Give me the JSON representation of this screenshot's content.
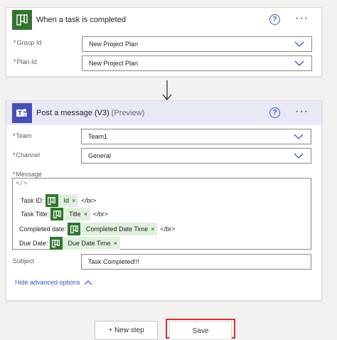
{
  "trigger": {
    "title": "When a task is completed",
    "fields": [
      {
        "label": "Group Id",
        "value": "New Project Plan"
      },
      {
        "label": "Plan Id",
        "value": "New Project Plan"
      }
    ],
    "help_glyph": "?",
    "more_glyph": "···"
  },
  "action": {
    "title": "Post a message (V3)",
    "preview_tag": "(Preview)",
    "help_glyph": "?",
    "more_glyph": "···",
    "team": {
      "label": "Team",
      "value": "Team1"
    },
    "channel": {
      "label": "Channel",
      "value": "General"
    },
    "message": {
      "label": "Message",
      "code_glyph": "</>",
      "lines": [
        {
          "prefix": "Task ID:",
          "token": "Id",
          "suffix": "</br>"
        },
        {
          "prefix": "Task Title:",
          "token": "Title",
          "suffix": "</br>"
        },
        {
          "prefix": "Completed date:",
          "token": "Completed Date Time",
          "suffix": "</br>"
        },
        {
          "prefix": "Due Date:",
          "token": "Due Date Time",
          "suffix": ""
        }
      ]
    },
    "subject": {
      "label": "Subject",
      "value": "Task Completed!!!"
    },
    "advanced_link": "Hide advanced options"
  },
  "footer": {
    "new_step_label": "+ New step",
    "save_label": "Save"
  },
  "required_marker": "*",
  "remove_glyph": "×",
  "colors": {
    "planner": "#31752f",
    "teams": "#464eb8",
    "link": "#3b55c8",
    "save_outline": "#d13438"
  },
  "icons": {
    "planner": "planner-app-icon",
    "teams": "teams-app-icon",
    "help": "help-icon",
    "more": "more-options-icon",
    "dropdown": "chevron-down-icon",
    "arrow": "arrow-down-icon"
  }
}
